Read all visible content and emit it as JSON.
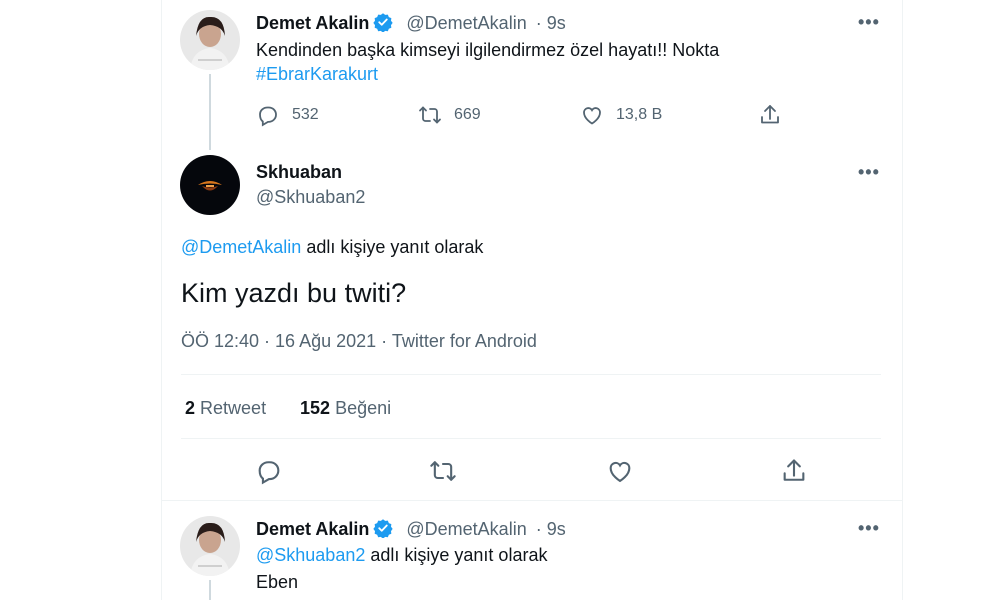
{
  "tweet1": {
    "name": "Demet Akalin",
    "handle": "@DemetAkalin",
    "time": "· 9s",
    "text": "Kendinden başka kimseyi ilgilendirmez özel hayatı!! Nokta",
    "hashtag": "#EbrarKarakurt",
    "reply_count": "532",
    "retweet_count": "669",
    "like_count": "13,8 B"
  },
  "main_tweet": {
    "name": "Skhuaban",
    "handle": "@Skhuaban2",
    "reply_to_handle": "@DemetAkalin",
    "reply_to_suffix": "adlı kişiye yanıt olarak",
    "text": "Kim yazdı bu twiti?",
    "timestamp": "ÖÖ 12:40 · 16 Ağu 2021 · Twitter for Android",
    "retweets_num": "2",
    "retweets_label": "Retweet",
    "likes_num": "152",
    "likes_label": "Beğeni"
  },
  "tweet3": {
    "name": "Demet Akalin",
    "handle": "@DemetAkalin",
    "time": "· 9s",
    "reply_to_handle": "@Skhuaban2",
    "reply_to_suffix": "adlı kişiye yanıt olarak",
    "text": "Eben"
  },
  "more_label": "•••",
  "colors": {
    "accent": "#1d9bf0",
    "muted": "#536471",
    "text": "#0f1419"
  }
}
